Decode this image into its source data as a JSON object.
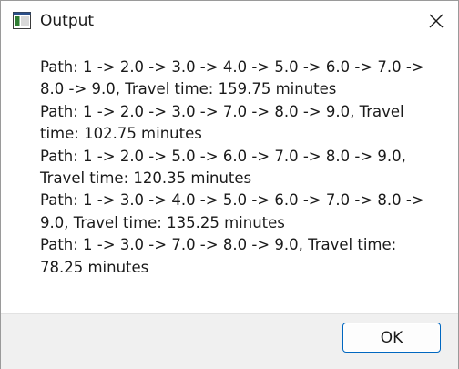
{
  "window": {
    "title": "Output",
    "app_icon": "window-app-icon",
    "close_icon": "close-icon"
  },
  "message": {
    "lines": [
      "Path: 1 -> 2.0 -> 3.0 -> 4.0 -> 5.0 -> 6.0 -> 7.0 ->",
      "8.0 -> 9.0, Travel time: 159.75 minutes",
      "Path: 1 -> 2.0 -> 3.0 -> 7.0 -> 8.0 -> 9.0, Travel",
      "time: 102.75 minutes",
      "Path: 1 -> 2.0 -> 5.0 -> 6.0 -> 7.0 -> 8.0 -> 9.0,",
      "Travel time: 120.35 minutes",
      "Path: 1 -> 3.0 -> 4.0 -> 5.0 -> 6.0 -> 7.0 -> 8.0 ->",
      "9.0, Travel time: 135.25 minutes",
      "Path: 1 -> 3.0 -> 7.0 -> 8.0 -> 9.0, Travel time:",
      "78.25 minutes"
    ]
  },
  "footer": {
    "ok_label": "OK"
  },
  "colors": {
    "accent": "#0067c0",
    "footer_bg": "#f0f0f0"
  }
}
